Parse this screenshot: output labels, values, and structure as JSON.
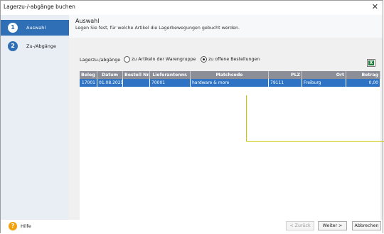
{
  "window": {
    "title": "Lagerzu-/-abgänge buchen"
  },
  "sidebar": {
    "steps": [
      {
        "number": "1",
        "label": "Auswahl"
      },
      {
        "number": "2",
        "label": "Zu-/Abgänge"
      }
    ]
  },
  "header": {
    "title": "Auswahl",
    "description": "Legen Sie fest, für welche Artikel die Lagerbewegungen gebucht werden."
  },
  "options": {
    "caption": "Lagerzu-/abgänge",
    "radio1": "zu Artikeln der Warengruppe",
    "radio2": "zu offene Bestellungen",
    "selected": "radio2"
  },
  "table": {
    "columns": [
      "Beleg Nr.",
      "Datum",
      "Bestell Nr.",
      "Lieferantennr.",
      "Matchcode",
      "PLZ",
      "Ort",
      "Betrag"
    ],
    "rows": [
      [
        "17001",
        "01.08.2025",
        "",
        "70001",
        "hardware & more",
        "79111",
        "Freiburg",
        "0,00"
      ]
    ]
  },
  "footer": {
    "help": "Hilfe",
    "back": "< Zurück",
    "next": "Weiter >",
    "cancel": "Abbrechen"
  },
  "colors": {
    "accent": "#2f6fb5",
    "row_selected": "#2f74c4",
    "header_bg": "#8b8e97",
    "annotation": "#c9c800"
  }
}
